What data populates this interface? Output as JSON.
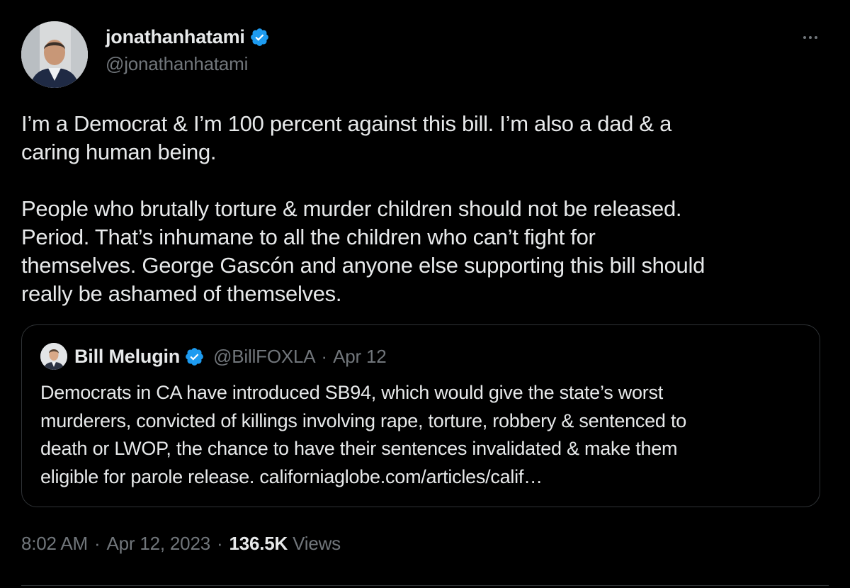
{
  "author": {
    "display_name": "jonathanhatami",
    "handle": "@jonathanhatami",
    "verified": true
  },
  "tweet": {
    "paragraphs": [
      "I’m a Democrat & I’m 100 percent against this bill. I’m also a dad & a\ncaring human being.",
      "People who brutally torture & murder children should not be released.\nPeriod. That’s inhumane to all the children who can’t fight for\nthemselves. George Gascón and anyone else supporting this bill should\nreally be ashamed of themselves."
    ]
  },
  "quote": {
    "display_name": "Bill Melugin",
    "handle": "@BillFOXLA",
    "separator": "·",
    "date": "Apr 12",
    "text": "Democrats in CA have introduced SB94, which would give the state’s worst\nmurderers, convicted of killings involving rape, torture, robbery & sentenced to\ndeath or LWOP, the chance to have their sentences invalidated & make them\neligible for parole release. californiaglobe.com/articles/calif…"
  },
  "meta": {
    "time": "8:02 AM",
    "separator": "·",
    "date": "Apr 12, 2023",
    "views_count": "136.5K",
    "views_label": "Views"
  },
  "icons": {
    "verified_badge": "verified-badge-icon",
    "more": "more-options-icon"
  },
  "colors": {
    "background": "#000000",
    "primary_text": "#e7e9ea",
    "secondary_text": "#71767b",
    "verified_blue": "#1d9bf0",
    "border": "#2f3336"
  }
}
